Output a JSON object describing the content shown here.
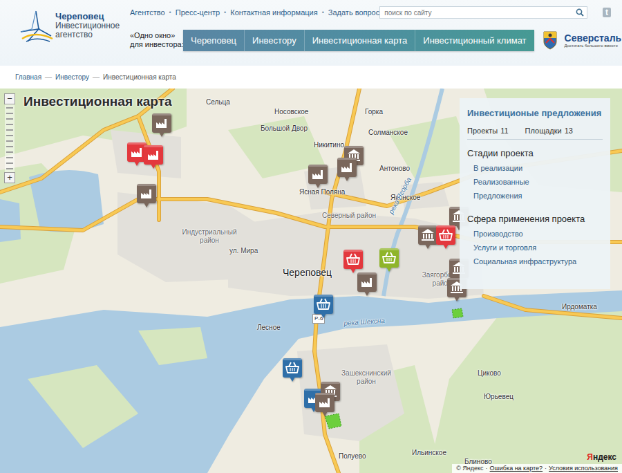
{
  "logo": {
    "city": "Череповец",
    "subtitle": "Инвестиционное агентство"
  },
  "top_links": {
    "items": [
      "Агентство",
      "Пресс-центр",
      "Контактная информация",
      "Задать вопрос"
    ],
    "separator": "•"
  },
  "search": {
    "placeholder": "поиск по сайту"
  },
  "social": {
    "twitter": "t"
  },
  "one_window": [
    "«Одно окно»",
    "для инвестора:"
  ],
  "nav": [
    {
      "label": "Череповец",
      "selected": false
    },
    {
      "label": "Инвестору",
      "selected": false
    },
    {
      "label": "Инвестиционная карта",
      "selected": false
    },
    {
      "label": "Инвестиционный климат",
      "selected": false
    }
  ],
  "partner": {
    "name": "Северсталь",
    "tagline": "Достигать большего вместе"
  },
  "breadcrumbs": {
    "items": [
      "Главная",
      "Инвестору",
      "Инвестиционная карта"
    ],
    "separator": "—"
  },
  "map": {
    "title": "Инвестиционная карта",
    "zoom_out": "−",
    "zoom_in": "+",
    "labels": [
      {
        "text": "Сельца",
        "kind": "village"
      },
      {
        "text": "Носовское",
        "kind": "village"
      },
      {
        "text": "Горка",
        "kind": "village"
      },
      {
        "text": "Большой Двор",
        "kind": "village"
      },
      {
        "text": "Солманское",
        "kind": "village"
      },
      {
        "text": "Никитино",
        "kind": "village"
      },
      {
        "text": "Антоново",
        "kind": "village"
      },
      {
        "text": "Ясная Поляна",
        "kind": "village"
      },
      {
        "text": "Яконское",
        "kind": "village"
      },
      {
        "text": "Северный район",
        "kind": "district"
      },
      {
        "text": "река Ягорба",
        "kind": "river"
      },
      {
        "text": "Индустриальный район",
        "kind": "district"
      },
      {
        "text": "ул. Мира",
        "kind": "street"
      },
      {
        "text": "Череповец",
        "kind": "city"
      },
      {
        "text": "Заягорбский район",
        "kind": "district"
      },
      {
        "text": "Р-6",
        "kind": "road"
      },
      {
        "text": "река Шексна",
        "kind": "river"
      },
      {
        "text": "Лесное",
        "kind": "village"
      },
      {
        "text": "Ирдоматка",
        "kind": "village"
      },
      {
        "text": "Зашекснинский район",
        "kind": "district"
      },
      {
        "text": "Циково",
        "kind": "village"
      },
      {
        "text": "Юрьевец",
        "kind": "village"
      },
      {
        "text": "Полуево",
        "kind": "village"
      },
      {
        "text": "Ильинское",
        "kind": "village"
      },
      {
        "text": "Блиново",
        "kind": "village"
      }
    ],
    "pins": [
      {
        "kind": "factory",
        "color": "#e3383d"
      },
      {
        "kind": "factory",
        "color": "#7a675c"
      },
      {
        "kind": "factory",
        "color": "#e3383d"
      },
      {
        "kind": "factory",
        "color": "#7a675c"
      },
      {
        "kind": "factory",
        "color": "#7a675c"
      },
      {
        "kind": "building",
        "color": "#7a675c"
      },
      {
        "kind": "factory",
        "color": "#7a675c"
      },
      {
        "kind": "building",
        "color": "#7a675c"
      },
      {
        "kind": "building",
        "color": "#7a675c"
      },
      {
        "kind": "basket",
        "color": "#e3383d"
      },
      {
        "kind": "basket",
        "color": "#e3383d"
      },
      {
        "kind": "basket",
        "color": "#8fb52a"
      },
      {
        "kind": "factory",
        "color": "#7a675c"
      },
      {
        "kind": "building",
        "color": "#7a675c"
      },
      {
        "kind": "building",
        "color": "#7a675c"
      },
      {
        "kind": "basket",
        "color": "#2f6fa8"
      },
      {
        "kind": "basket",
        "color": "#2f6fa8"
      },
      {
        "kind": "factory",
        "color": "#2f6fa8"
      },
      {
        "kind": "building",
        "color": "#7a675c"
      },
      {
        "kind": "factory",
        "color": "#7a675c"
      }
    ],
    "attribution": {
      "logo": "Яндекс",
      "copyright": "© Яндекс",
      "separator": "·",
      "error": "Ошибка на карте?",
      "terms": "Условия использования"
    }
  },
  "panel": {
    "title": "Инвестиционые предложения",
    "tabs": [
      {
        "label": "Проекты",
        "count": "11",
        "selected": false
      },
      {
        "label": "Площадки",
        "count": "13",
        "selected": false
      }
    ],
    "sections": [
      {
        "title": "Стадии проекта",
        "items": [
          "В реализации",
          "Реализованные",
          "Предложения"
        ]
      },
      {
        "title": "Сфера применения проекта",
        "items": [
          "Производство",
          "Услуги и торговля",
          "Социальная инфраструктура"
        ]
      }
    ]
  }
}
